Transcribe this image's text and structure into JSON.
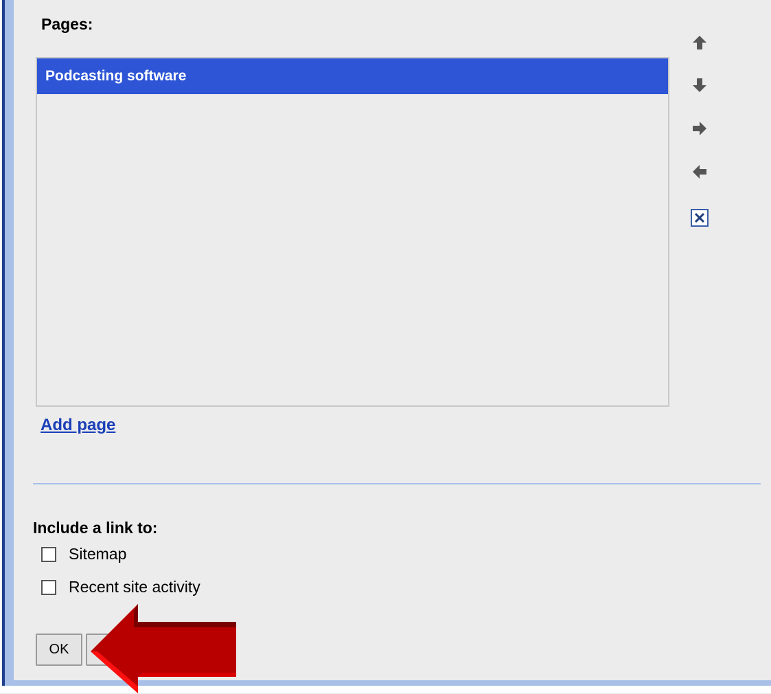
{
  "pages_section": {
    "label": "Pages:",
    "items": [
      {
        "label": "Podcasting software",
        "selected": true
      }
    ],
    "add_page_label": "Add page"
  },
  "tools": [
    {
      "icon": "arrow-up-icon"
    },
    {
      "icon": "arrow-down-icon"
    },
    {
      "icon": "arrow-right-icon"
    },
    {
      "icon": "arrow-left-icon"
    },
    {
      "icon": "delete-icon"
    }
  ],
  "include_section": {
    "label": "Include a link to:",
    "options": [
      {
        "label": "Sitemap",
        "checked": false
      },
      {
        "label": "Recent site activity",
        "checked": false
      }
    ]
  },
  "buttons": {
    "ok_label": "OK"
  },
  "colors": {
    "selection": "#2d55d6",
    "link": "#1a3fb8",
    "annotation_arrow": "#c00000"
  }
}
